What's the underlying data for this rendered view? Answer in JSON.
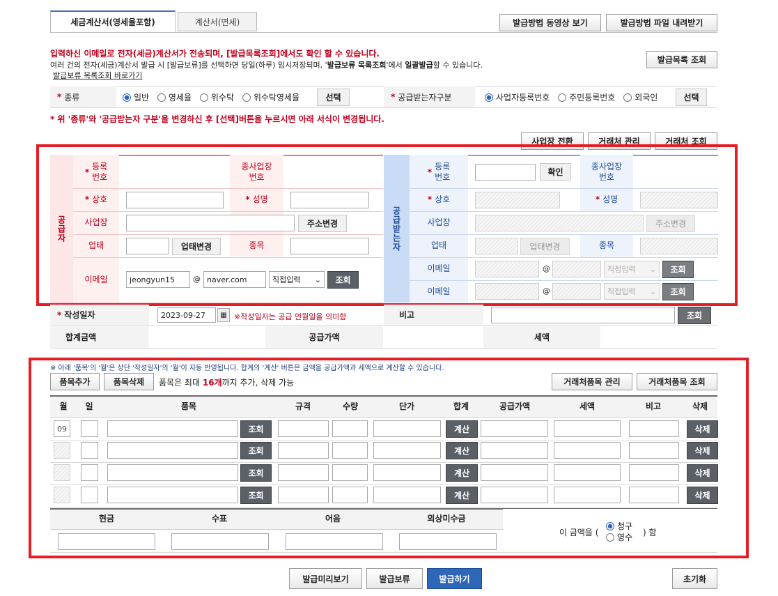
{
  "tabs": {
    "active": "세금계산서(영세율포함)",
    "inactive": "계산서(면세)"
  },
  "top_buttons": {
    "video": "발급방법 동영상 보기",
    "file": "발급방법 파일 내려받기",
    "list": "발급목록 조회"
  },
  "notice": {
    "line1": "입력하신 이메일로 전자(세금)계산서가 전송되며, [발급목록조회]에서도 확인 할 수 있습니다.",
    "line2_a": "여러 건의 전자(세금)계산서 발급 시 [발급보류]를 선택하면 당일(하루) 임시저장되며, '",
    "line2_b": "발급보류 목록조회",
    "line2_c": "'에서 ",
    "line2_d": "일괄발급",
    "line2_e": "할 수 있습니다.",
    "link": "발급보류 목록조회 바로가기"
  },
  "type_row": {
    "label": "종류",
    "options": [
      "일반",
      "영세율",
      "위수탁",
      "위수탁영세율"
    ],
    "select": "선택",
    "receiver_label": "공급받는자구분",
    "receiver_options": [
      "사업자등록번호",
      "주민등록번호",
      "외국인"
    ],
    "receiver_select": "선택"
  },
  "warning": "* 위 '종류'와 '공급받는자 구분'을 변경하신 후 [선택]버튼을 누르시면 아래 서식이 변경됩니다.",
  "business_buttons": {
    "switch": "사업장 전환",
    "manage": "거래처 관리",
    "lookup": "거래처 조회"
  },
  "supplier": {
    "title": "공급자",
    "reg_no": "등록\n번호",
    "sub_no": "종사업장\n번호",
    "name": "상호",
    "ceo": "성명",
    "address": "사업장",
    "address_btn": "주소변경",
    "biz_type": "업태",
    "biz_type_btn": "업태변경",
    "item": "종목",
    "email": "이메일",
    "email_id": "jeongyun15",
    "email_domain": "naver.com",
    "email_select": "직접입력",
    "email_btn": "조회"
  },
  "buyer": {
    "title": "공급받는자",
    "reg_no": "등록\n번호",
    "confirm_btn": "확인",
    "sub_no": "종사업장\n번호",
    "name": "상호",
    "ceo": "성명",
    "address": "사업장",
    "address_btn": "주소변경",
    "biz_type": "업태",
    "biz_type_btn": "업태변경",
    "item": "종목",
    "email": "이메일",
    "email2": "이메일",
    "email_select": "직접입력",
    "email_btn": "조회"
  },
  "date_row": {
    "label": "작성일자",
    "value": "2023-09-27",
    "note": "※작성일자는 공급 연월일을 의미함",
    "remark_label": "비고",
    "remark_btn": "조회"
  },
  "totals": {
    "total": "합계금액",
    "supply": "공급가액",
    "tax": "세액"
  },
  "items": {
    "notice": "※ 아래 '품목'의 '월'은 상단 '작성일자'의 '월'이 자동 반영됩니다. 합계의 '계산' 버튼은 금액을 공급가액과 세액으로 계산할 수 있습니다.",
    "add_btn": "품목추가",
    "del_btn": "품목삭제",
    "limit_a": "품목은 최대 ",
    "limit_b": "16개",
    "limit_c": "까지 추가, 삭제 가능",
    "manage_btn": "거래처품목 관리",
    "lookup_btn": "거래처품목 조회",
    "headers": [
      "월",
      "일",
      "품목",
      "규격",
      "수량",
      "단가",
      "합계",
      "공급가액",
      "세액",
      "비고",
      "삭제"
    ],
    "first_month": "09",
    "row_lookup": "조회",
    "row_calc": "계산",
    "row_delete": "삭제"
  },
  "payment": {
    "headers": [
      "현금",
      "수표",
      "어음",
      "외상미수금"
    ],
    "text_a": "이 금액을 (",
    "text_b": ") 함",
    "opt1": "청구",
    "opt2": "영수"
  },
  "bottom_buttons": {
    "preview": "발급미리보기",
    "hold": "발급보류",
    "issue": "발급하기",
    "reset": "초기화"
  }
}
